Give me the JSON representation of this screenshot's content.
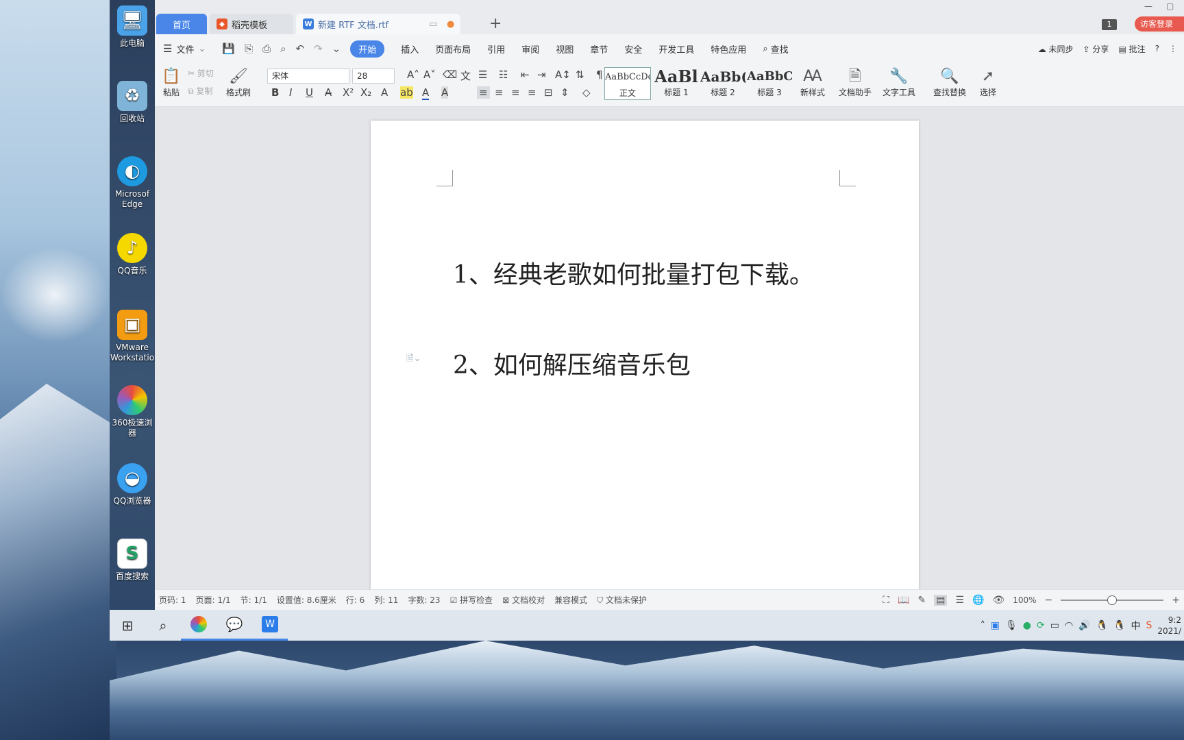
{
  "desktop": {
    "icons": [
      {
        "label": "此电脑",
        "icon": "computer-icon",
        "color": "#4aa3e8",
        "glyph": "🖥"
      },
      {
        "label": "回收站",
        "icon": "recycle-bin-icon",
        "color": "#7fb3d8",
        "glyph": "♻"
      },
      {
        "label": "Microsof Edge",
        "icon": "edge-icon",
        "color": "#1e9be0",
        "glyph": "◐"
      },
      {
        "label": "QQ音乐",
        "icon": "qq-music-icon",
        "color": "#f5d800",
        "glyph": "♪"
      },
      {
        "label": "VMware Workstatio",
        "icon": "vmware-icon",
        "color": "#f39c12",
        "glyph": "▣"
      },
      {
        "label": "360极速浏 器",
        "icon": "360-browser-icon",
        "color": "#e84c3d",
        "glyph": "◉"
      },
      {
        "label": "QQ浏览器",
        "icon": "qq-browser-icon",
        "color": "#3aa0f0",
        "glyph": "◒"
      },
      {
        "label": "百度搜索",
        "icon": "spreadsheet-icon",
        "color": "#21a366",
        "glyph": "S"
      }
    ]
  },
  "tabs": {
    "home": "首页",
    "templates": "稻壳模板",
    "document": "新建 RTF 文档.rtf",
    "page_count_badge": "1",
    "login": "访客登录"
  },
  "menu": {
    "file": "文件",
    "items": [
      "开始",
      "插入",
      "页面布局",
      "引用",
      "审阅",
      "视图",
      "章节",
      "安全",
      "开发工具",
      "特色应用"
    ],
    "active": "开始",
    "search": "查找",
    "right": {
      "sync": "未同步",
      "share": "分享",
      "comment": "批注"
    }
  },
  "ribbon": {
    "paste": "粘贴",
    "cut": "剪切",
    "copy": "复制",
    "format_painter": "格式刷",
    "font_name": "宋体",
    "font_size": "28",
    "styles": [
      {
        "preview": "AaBbCcDd",
        "label": "正文"
      },
      {
        "preview": "AaBl",
        "label": "标题 1"
      },
      {
        "preview": "AaBb(",
        "label": "标题 2"
      },
      {
        "preview": "AaBbC",
        "label": "标题 3"
      }
    ],
    "new_style": "新样式",
    "doc_assistant": "文档助手",
    "text_tools": "文字工具",
    "find_replace": "查找替换",
    "select": "选择"
  },
  "document": {
    "paragraphs": [
      "1、经典老歌如何批量打包下载。",
      "2、如何解压缩音乐包"
    ]
  },
  "status": {
    "page_code": "页码: 1",
    "pages": "页面: 1/1",
    "section": "节: 1/1",
    "setting": "设置值: 8.6厘米",
    "row": "行: 6",
    "col": "列: 11",
    "words": "字数: 23",
    "spellcheck": "拼写检查",
    "proofread": "文档校对",
    "compat": "兼容模式",
    "protect": "文档未保护",
    "zoom": "100%"
  },
  "taskbar": {
    "clock_time": "9:2",
    "clock_date": "2021/",
    "ime": "中"
  }
}
